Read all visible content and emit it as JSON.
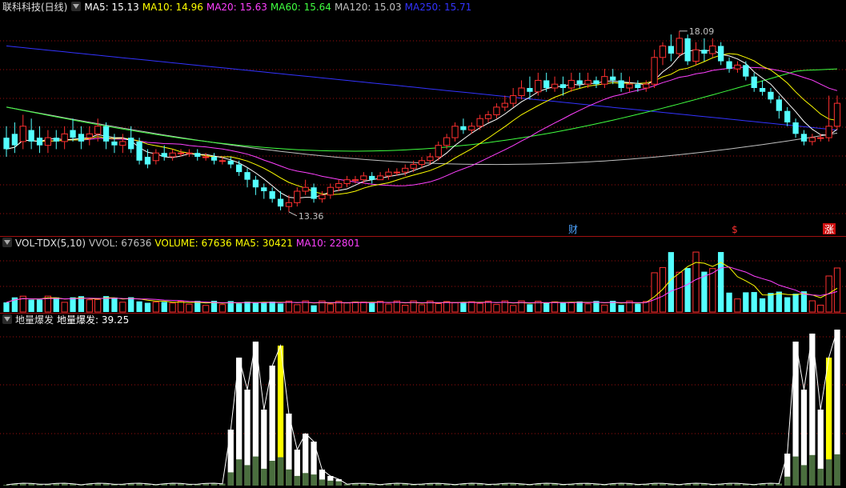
{
  "main": {
    "title": "联科科技(日线)",
    "ma": [
      {
        "label": "MA5: 15.13",
        "color": "#ffffff"
      },
      {
        "label": "MA10: 14.96",
        "color": "#ffff00"
      },
      {
        "label": "MA20: 15.63",
        "color": "#ff40ff"
      },
      {
        "label": "MA60: 15.64",
        "color": "#40ff40"
      },
      {
        "label": "MA120: 15.03",
        "color": "#c0c0c0"
      },
      {
        "label": "MA250: 15.71",
        "color": "#3333ff"
      }
    ],
    "high_label": "18.09",
    "low_label": "13.36",
    "markers": [
      {
        "text": "财",
        "color": "#4da3ff",
        "bg": "none"
      },
      {
        "text": "$",
        "color": "#ff3030",
        "bg": "none"
      },
      {
        "text": "涨",
        "color": "#ffffff",
        "bg": "#d01010"
      }
    ]
  },
  "vol": {
    "title": "VOL-TDX(5,10)",
    "fields": [
      {
        "label": "VVOL: 67636",
        "color": "#c0c0c0"
      },
      {
        "label": "VOLUME: 67636",
        "color": "#ffff00"
      },
      {
        "label": "MA5: 30421",
        "color": "#ffff00"
      },
      {
        "label": "MA10: 22801",
        "color": "#ff40ff"
      }
    ]
  },
  "ind": {
    "title": "地量爆发",
    "fields": [
      {
        "label": "地量爆发: 39.25",
        "color": "#ffffff"
      }
    ]
  },
  "colors": {
    "up": "#ff3030",
    "down": "#54ffff",
    "ma5": "#ffffff",
    "ma10": "#ffff00",
    "ma20": "#ff40ff",
    "ma60": "#40ff40",
    "ma120": "#c0c0c0",
    "ma250": "#3333ff",
    "grid": "#a01010",
    "bar_white": "#ffffff",
    "bar_yellow": "#ffff00",
    "bar_green": "#4a6e3e"
  },
  "chart_data": {
    "type": "candlestick",
    "high": 18.09,
    "low": 13.36,
    "ohlc": [
      [
        15.3,
        15.0,
        15.6,
        14.8
      ],
      [
        15.4,
        15.1,
        15.7,
        14.9
      ],
      [
        15.2,
        15.6,
        15.9,
        15.0
      ],
      [
        15.5,
        15.2,
        15.8,
        15.0
      ],
      [
        15.3,
        15.1,
        15.6,
        14.9
      ],
      [
        15.1,
        15.3,
        15.5,
        14.9
      ],
      [
        15.3,
        15.2,
        15.5,
        15.0
      ],
      [
        15.2,
        15.4,
        15.6,
        15.0
      ],
      [
        15.5,
        15.3,
        15.8,
        15.2
      ],
      [
        15.4,
        15.2,
        15.6,
        15.0
      ],
      [
        15.3,
        15.4,
        15.6,
        15.1
      ],
      [
        15.4,
        15.6,
        15.8,
        15.2
      ],
      [
        15.6,
        15.2,
        15.7,
        15.0
      ],
      [
        15.2,
        15.1,
        15.4,
        14.9
      ],
      [
        15.1,
        15.2,
        15.4,
        14.9
      ],
      [
        15.3,
        15.0,
        15.6,
        14.9
      ],
      [
        15.2,
        14.7,
        15.3,
        14.6
      ],
      [
        14.8,
        14.6,
        15.0,
        14.5
      ],
      [
        14.7,
        14.9,
        15.0,
        14.6
      ],
      [
        14.9,
        14.8,
        15.1,
        14.7
      ],
      [
        14.8,
        14.9,
        15.0,
        14.7
      ],
      [
        14.9,
        14.9,
        15.0,
        14.8
      ],
      [
        14.9,
        14.9,
        15.0,
        14.8
      ],
      [
        14.9,
        14.8,
        15.0,
        14.7
      ],
      [
        14.8,
        14.8,
        14.9,
        14.7
      ],
      [
        14.8,
        14.7,
        14.9,
        14.6
      ],
      [
        14.7,
        14.7,
        14.8,
        14.6
      ],
      [
        14.7,
        14.6,
        14.8,
        14.5
      ],
      [
        14.6,
        14.4,
        14.7,
        14.3
      ],
      [
        14.4,
        14.2,
        14.5,
        14.0
      ],
      [
        14.2,
        14.0,
        14.3,
        13.8
      ],
      [
        14.0,
        13.9,
        14.1,
        13.7
      ],
      [
        13.9,
        13.7,
        14.0,
        13.6
      ],
      [
        13.7,
        13.5,
        13.9,
        13.4
      ],
      [
        13.5,
        13.6,
        13.8,
        13.36
      ],
      [
        13.6,
        13.9,
        14.0,
        13.5
      ],
      [
        13.9,
        14.0,
        14.2,
        13.8
      ],
      [
        14.0,
        13.7,
        14.1,
        13.6
      ],
      [
        13.7,
        13.8,
        13.9,
        13.6
      ],
      [
        13.8,
        14.0,
        14.1,
        13.7
      ],
      [
        14.0,
        14.1,
        14.2,
        13.9
      ],
      [
        14.1,
        14.2,
        14.3,
        14.0
      ],
      [
        14.2,
        14.2,
        14.3,
        14.1
      ],
      [
        14.2,
        14.3,
        14.4,
        14.1
      ],
      [
        14.3,
        14.2,
        14.4,
        14.1
      ],
      [
        14.2,
        14.3,
        14.4,
        14.2
      ],
      [
        14.3,
        14.4,
        14.5,
        14.2
      ],
      [
        14.4,
        14.4,
        14.5,
        14.3
      ],
      [
        14.4,
        14.5,
        14.6,
        14.3
      ],
      [
        14.5,
        14.6,
        14.7,
        14.4
      ],
      [
        14.6,
        14.7,
        14.8,
        14.5
      ],
      [
        14.7,
        14.8,
        14.9,
        14.6
      ],
      [
        14.8,
        15.1,
        15.2,
        14.7
      ],
      [
        15.1,
        15.3,
        15.4,
        15.0
      ],
      [
        15.3,
        15.6,
        15.7,
        15.2
      ],
      [
        15.6,
        15.5,
        15.8,
        15.4
      ],
      [
        15.5,
        15.6,
        15.7,
        15.4
      ],
      [
        15.6,
        15.8,
        15.9,
        15.5
      ],
      [
        15.8,
        15.9,
        16.0,
        15.7
      ],
      [
        15.9,
        16.1,
        16.2,
        15.8
      ],
      [
        16.1,
        16.2,
        16.4,
        16.0
      ],
      [
        16.2,
        16.4,
        16.6,
        16.1
      ],
      [
        16.4,
        16.6,
        16.8,
        16.3
      ],
      [
        16.6,
        16.5,
        16.9,
        16.3
      ],
      [
        16.5,
        16.8,
        17.0,
        16.4
      ],
      [
        16.8,
        16.6,
        17.0,
        16.5
      ],
      [
        16.6,
        16.7,
        16.9,
        16.5
      ],
      [
        16.7,
        16.6,
        16.9,
        16.4
      ],
      [
        16.6,
        16.8,
        17.0,
        16.5
      ],
      [
        16.8,
        16.7,
        17.0,
        16.6
      ],
      [
        16.7,
        16.8,
        17.0,
        16.6
      ],
      [
        16.8,
        16.7,
        16.9,
        16.6
      ],
      [
        16.7,
        16.9,
        17.1,
        16.6
      ],
      [
        16.9,
        16.8,
        17.1,
        16.7
      ],
      [
        16.8,
        16.6,
        17.0,
        16.5
      ],
      [
        16.6,
        16.7,
        16.9,
        16.5
      ],
      [
        16.7,
        16.6,
        16.8,
        16.5
      ],
      [
        16.6,
        16.7,
        16.8,
        16.5
      ],
      [
        16.7,
        17.4,
        17.6,
        16.6
      ],
      [
        17.4,
        17.7,
        17.8,
        17.2
      ],
      [
        17.7,
        17.5,
        18.0,
        17.3
      ],
      [
        17.5,
        17.9,
        18.09,
        17.4
      ],
      [
        17.9,
        17.3,
        18.0,
        17.2
      ],
      [
        17.3,
        17.6,
        17.8,
        17.2
      ],
      [
        17.6,
        17.5,
        17.9,
        17.3
      ],
      [
        17.5,
        17.7,
        17.9,
        17.4
      ],
      [
        17.7,
        17.3,
        17.8,
        17.2
      ],
      [
        17.3,
        17.1,
        17.4,
        17.0
      ],
      [
        17.1,
        17.2,
        17.3,
        17.0
      ],
      [
        17.2,
        16.9,
        17.3,
        16.8
      ],
      [
        16.9,
        16.6,
        17.0,
        16.5
      ],
      [
        16.6,
        16.5,
        16.8,
        16.4
      ],
      [
        16.5,
        16.3,
        16.6,
        16.2
      ],
      [
        16.3,
        16.0,
        16.4,
        15.8
      ],
      [
        16.0,
        15.7,
        16.1,
        15.6
      ],
      [
        15.7,
        15.4,
        15.8,
        15.3
      ],
      [
        15.4,
        15.2,
        15.5,
        15.1
      ],
      [
        15.2,
        15.3,
        15.4,
        15.1
      ],
      [
        15.3,
        15.3,
        15.4,
        15.2
      ],
      [
        15.3,
        15.6,
        16.4,
        15.2
      ],
      [
        15.6,
        16.2,
        16.4,
        15.5
      ]
    ]
  }
}
